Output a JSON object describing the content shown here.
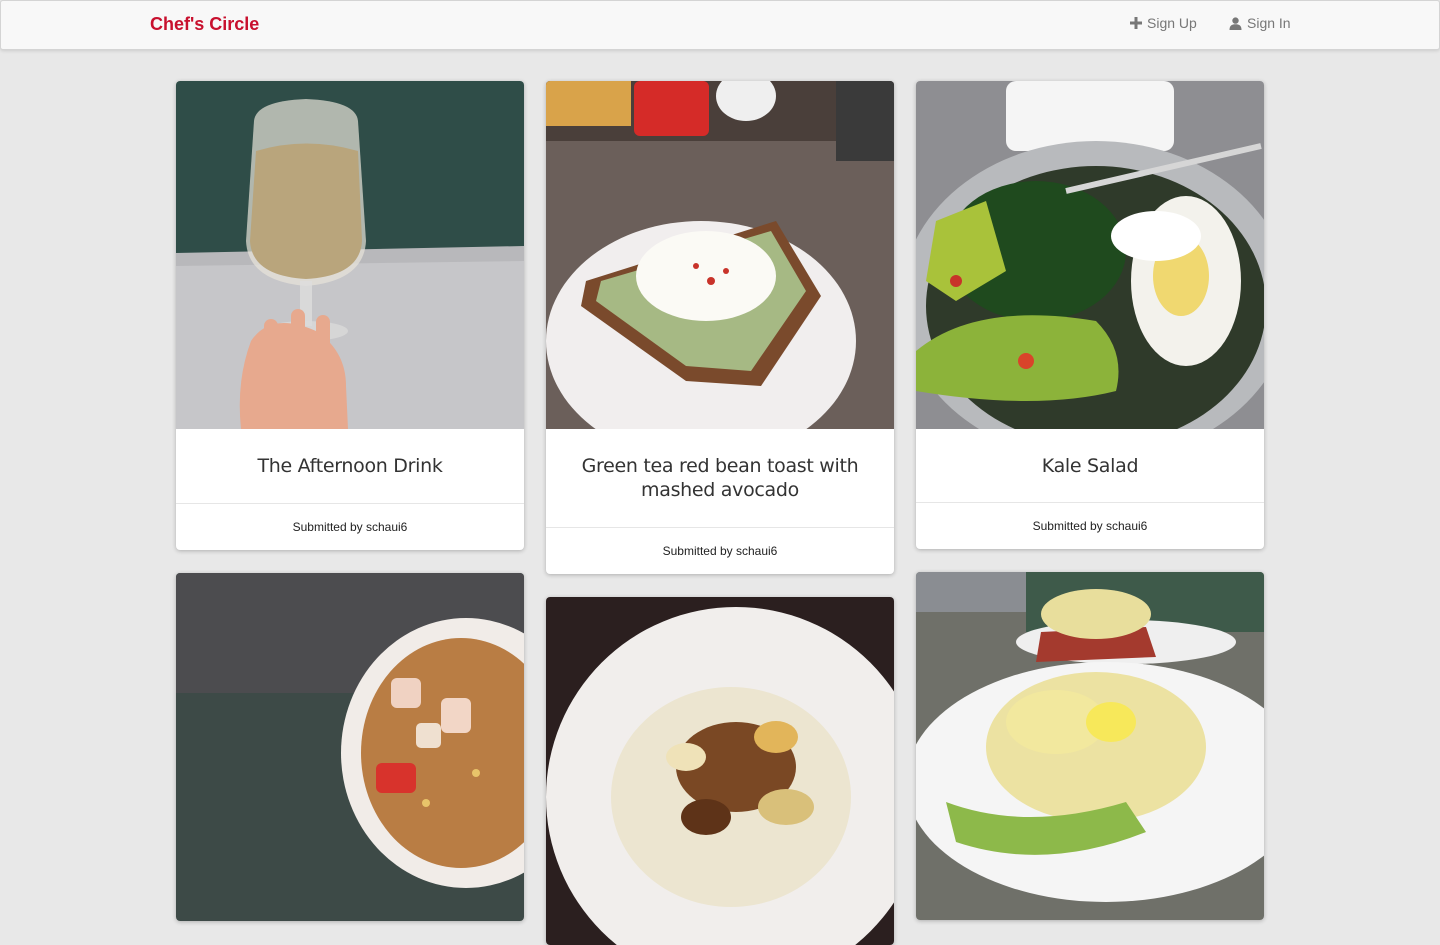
{
  "nav": {
    "brand": "Chef's Circle",
    "sign_up": "Sign Up",
    "sign_up_icon": "plus-icon",
    "sign_in": "Sign In",
    "sign_in_icon": "user-icon"
  },
  "colors": {
    "brand": "#c8102e",
    "background": "#e8e8e8"
  },
  "recipes": [
    {
      "title": "The Afternoon Drink",
      "footer": "Submitted by schaui6"
    },
    {
      "title": "Green tea red bean toast with mashed avocado",
      "footer": "Submitted by schaui6"
    },
    {
      "title": "Kale Salad",
      "footer": "Submitted by schaui6"
    }
  ]
}
